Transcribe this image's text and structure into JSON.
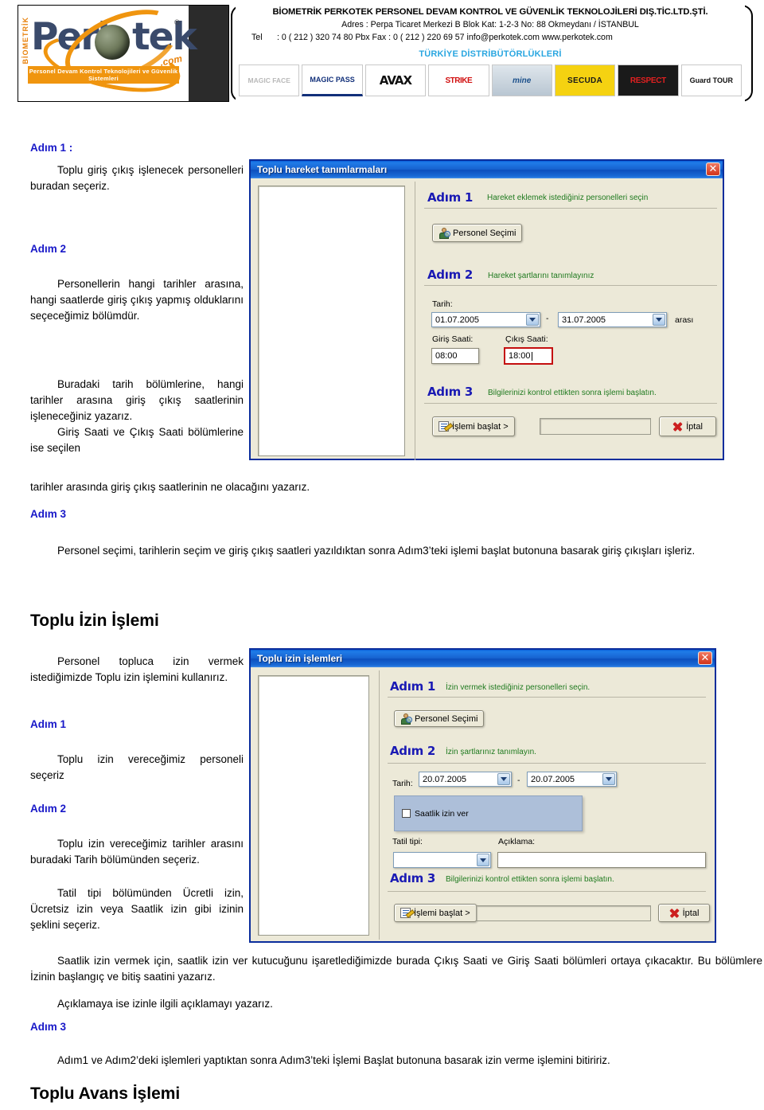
{
  "header": {
    "logo": {
      "vertical_text": "BİOMETRİK",
      "wordmark": "Perk tek",
      "com": ".com",
      "registered": "®",
      "tagline": "Personel Devam Kontrol Teknolojileri ve Güvenlik Sistemleri"
    },
    "company_line": "BİOMETRİK PERKOTEK PERSONEL DEVAM KONTROL VE GÜVENLİK TEKNOLOJİLERİ DIŞ.TİC.LTD.ŞTİ.",
    "address_line": "Adres : Perpa Ticaret Merkezi B Blok Kat: 1-2-3  No: 88   Okmeydanı  /  İSTANBUL",
    "tel_label": "Tel",
    "tel_line": ": 0 ( 212 ) 320 74 80 Pbx Fax :  0 ( 212 ) 220 69 57   info@perkotek.com   www.perkotek.com",
    "distributors_title": "TÜRKİYE DİSTRİBÜTÖRLÜKLERİ",
    "distributors": [
      "MAGIC FACE",
      "MAGIC PASS",
      "AVAX",
      "STRIKE",
      "mine",
      "SECUDA",
      "RESPECT",
      "Guard TOUR"
    ]
  },
  "section1": {
    "step1_heading": "Adım 1 :",
    "step1_text": "Toplu giriş çıkış işlenecek personelleri buradan seçeriz.",
    "step2_heading": "Adım 2",
    "step2_text": "Personellerin hangi tarihler arasına, hangi saatlerde giriş çıkış yapmış olduklarını seçeceğimiz bölümdür.",
    "para3": "Buradaki tarih bölümlerine, hangi tarihler arasına giriş çıkış saatlerinin işleneceğiniz yazarız.",
    "para4a": "Giriş Saati ve Çıkış Saati bölümlerine ise seçilen",
    "para4b": "tarihler arasında giriş çıkış saatlerinin ne olacağını yazarız.",
    "step3_heading": "Adım 3",
    "step3_text": "Personel seçimi, tarihlerin seçim ve giriş çıkış saatleri yazıldıktan sonra Adım3’teki işlemi başlat butonuna basarak giriş çıkışları işleriz."
  },
  "dialog1": {
    "title": "Toplu hareket tanımlarmaları",
    "close_label": "✕",
    "step1_label": "Adım 1",
    "step1_desc": "Hareket eklemek istediğiniz personelleri seçin",
    "personel_button": "Personel Seçimi",
    "step2_label": "Adım 2",
    "step2_desc": "Hareket şartlarını tanımlayınız",
    "tarih_label": "Tarih:",
    "date_start": "01.07.2005",
    "date_sep": "-",
    "date_end": "31.07.2005",
    "arasi_label": "arası",
    "giris_label": "Giriş Saati:",
    "cikis_label": "Çıkış Saati:",
    "giris_value": "08:00",
    "cikis_value": "18:00",
    "step3_label": "Adım 3",
    "step3_desc": "Bilgilerinizi kontrol ettikten sonra işlemi başlatın.",
    "start_button": "İşlemi başlat >",
    "cancel_button": "İptal"
  },
  "section2": {
    "title": "Toplu İzin İşlemi",
    "intro": "Personel topluca izin vermek istediğimizde Toplu izin işlemini kullanırız.",
    "step1_heading": "Adım 1",
    "step1_text": "Toplu izin vereceğimiz personeli seçeriz",
    "step2_heading": "Adım 2",
    "step2_text": "Toplu izin vereceğimiz tarihler arasını buradaki Tarih bölümünden seçeriz.",
    "step2_text2": "Tatil tipi bölümünden Ücretli izin, Ücretsiz izin veya Saatlik izin gibi izinin şeklini seçeriz.",
    "para_wide1": "Saatlik izin vermek için, saatlik izin ver kutucuğunu işaretlediğimizde burada Çıkış Saati ve Giriş Saati bölümleri ortaya çıkacaktır. Bu bölümlere İzinin başlangıç ve bitiş saatini yazarız.",
    "para_wide2": "Açıklamaya ise izinle ilgili açıklamayı yazarız.",
    "step3_heading": "Adım 3",
    "step3_text": "Adım1 ve Adım2’deki işlemleri yaptıktan sonra Adım3’teki İşlemi Başlat butonuna basarak izin verme işlemini bitiririz."
  },
  "dialog2": {
    "title": "Toplu izin işlemleri",
    "close_label": "✕",
    "step1_label": "Adım 1",
    "step1_desc": "İzin vermek istediğiniz personelleri seçin.",
    "personel_button": "Personel Seçimi",
    "step2_label": "Adım 2",
    "step2_desc": "İzin şartlarınız tanımlayın.",
    "tarih_label": "Tarih:",
    "date_start": "20.07.2005",
    "date_sep": "-",
    "date_end": "20.07.2005",
    "saatlik_checkbox": "Saatlik izin ver",
    "tatil_label": "Tatil tipi:",
    "tatil_value": "",
    "aciklama_label": "Açıklama:",
    "aciklama_value": "",
    "step3_label": "Adım 3",
    "step3_desc": "Bilgilerinizi kontrol ettikten sonra işlemi başlatın.",
    "start_button": "İşlemi başlat >",
    "cancel_button": "İptal"
  },
  "footer_title": "Toplu Avans İşlemi"
}
